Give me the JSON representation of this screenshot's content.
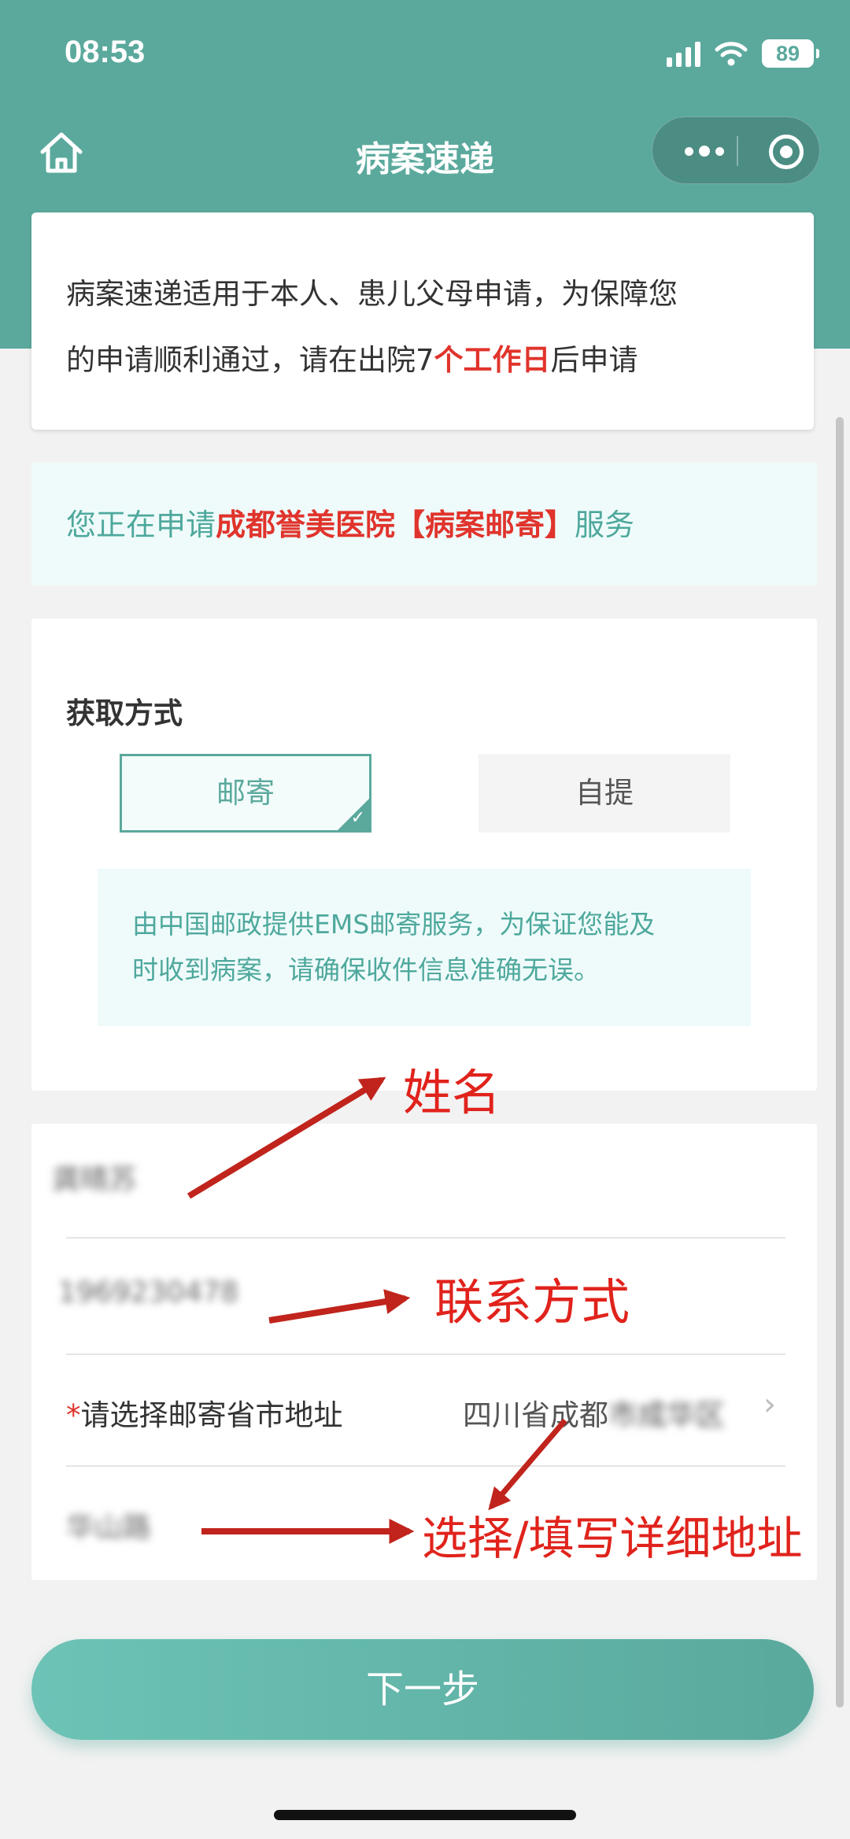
{
  "status_bar": {
    "time": "08:53",
    "battery": "89"
  },
  "nav": {
    "title": "病案速递"
  },
  "notice": {
    "line1": "病案速递适用于本人、患儿父母申请，为保障您",
    "line2_pre": "的申请顺利通过，请在出院7",
    "line2_highlight": "个工作日",
    "line2_post": "后申请"
  },
  "service": {
    "pre": "您正在申请",
    "highlight": "成都誉美医院【病案邮寄】",
    "post": "服务"
  },
  "method": {
    "title": "获取方式",
    "options": [
      "邮寄",
      "自提"
    ],
    "selected": "邮寄",
    "tip_line1": "由中国邮政提供EMS邮寄服务，为保证您能及",
    "tip_line2": "时收到病案，请确保收件信息准确无误。"
  },
  "form": {
    "name_value": "龚晴苏",
    "phone_value": "1969230478",
    "address_label": "请选择邮寄省市地址",
    "address_required_mark": "*",
    "address_value_visible": "四川省成都",
    "address_value_blurred": "市成华区",
    "detail_value": "华山路"
  },
  "annotations": {
    "name": "姓名",
    "contact": "联系方式",
    "address": "选择/填写详细地址"
  },
  "footer": {
    "next_label": "下一步"
  },
  "colors": {
    "theme": "#5ba99d",
    "highlight": "#e0342c",
    "annotation": "#e0231c"
  }
}
